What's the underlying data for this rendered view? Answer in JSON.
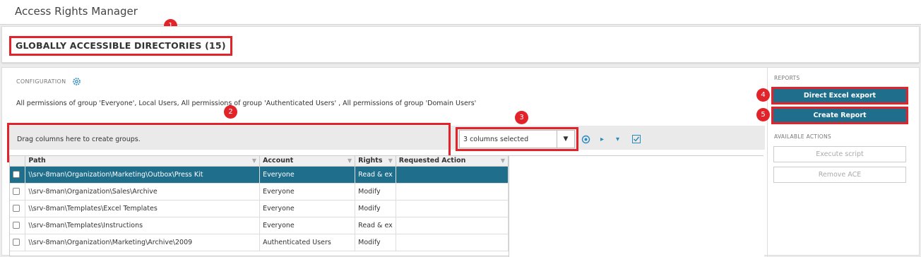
{
  "app": {
    "title": "Access Rights Manager"
  },
  "section": {
    "title": "GLOBALLY ACCESSIBLE DIRECTORIES (15)"
  },
  "config": {
    "label": "CONFIGURATION",
    "description": "All permissions of group 'Everyone', Local Users, All permissions of group 'Authenticated Users' , All permissions of group 'Domain Users'"
  },
  "grouping": {
    "hint": "Drag columns here to create groups."
  },
  "columns_select": {
    "value": "3 columns selected"
  },
  "grid": {
    "headers": [
      "Path",
      "Account",
      "Rights",
      "Requested Action"
    ],
    "rows": [
      {
        "path": "\\\\srv-8man\\Organization\\Marketing\\Outbox\\Press Kit",
        "account": "Everyone",
        "rights": "Read & ex",
        "selected": true
      },
      {
        "path": "\\\\srv-8man\\Organization\\Sales\\Archive",
        "account": "Everyone",
        "rights": "Modify",
        "selected": false
      },
      {
        "path": "\\\\srv-8man\\Templates\\Excel Templates",
        "account": "Everyone",
        "rights": "Modify",
        "selected": false
      },
      {
        "path": "\\\\srv-8man\\Templates\\Instructions",
        "account": "Everyone",
        "rights": "Read & ex",
        "selected": false
      },
      {
        "path": "\\\\srv-8man\\Organization\\Marketing\\Archive\\2009",
        "account": "Authenticated Users",
        "rights": "Modify",
        "selected": false
      }
    ]
  },
  "reports": {
    "label": "REPORTS",
    "excel_export": "Direct Excel export",
    "create_report": "Create Report"
  },
  "actions": {
    "label": "AVAILABLE ACTIONS",
    "execute_script": "Execute script",
    "remove_ace": "Remove ACE"
  },
  "callouts": [
    "1",
    "2",
    "3",
    "4",
    "5"
  ],
  "colors": {
    "accent": "#1f6e8c",
    "callout": "#e2232a",
    "icon": "#2c8bbd"
  },
  "icons": [
    "gear-icon",
    "refresh-icon",
    "play-icon",
    "dropdown-icon",
    "checklist-icon",
    "filter-icon"
  ]
}
